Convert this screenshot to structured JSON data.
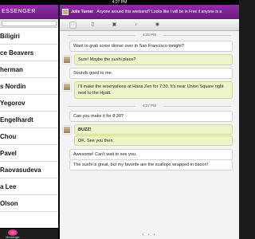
{
  "status_bar": {
    "time": "4:27 PM"
  },
  "left_panel": {
    "title": "ESSENGER",
    "contacts": [
      "Biligiri",
      "ce Beavers",
      "herman",
      "s Nordin",
      "Yegorov",
      "Engelhardt",
      "Chou",
      "Pavel",
      "Raovasudeva",
      "a Lee",
      "Olson"
    ],
    "footer_label": "Messenger"
  },
  "conversation": {
    "contact_name": "Julie Turner",
    "status_text": "Anyone around this weekend? Looks like I will be in Free if anyone is a",
    "time_1": "4:25 PM",
    "time_2": "4:27 PM",
    "messages": [
      {
        "from": "me",
        "text": "Want to grab some dinner over in San Francisco tonight?"
      },
      {
        "from": "them",
        "text": "Sure! Maybe the sushi place?"
      },
      {
        "from": "me",
        "text": "Sounds good to me."
      },
      {
        "from": "them",
        "text": "I'll make the reservations at Hana Zen for 7:30. It's near Union Square right next to the Hyatt."
      },
      {
        "from": "me",
        "text": "Can you make it for 8:30?"
      },
      {
        "from": "them",
        "text": "BUZZ!"
      },
      {
        "from": "them",
        "text": "OK. See you then."
      },
      {
        "from": "me",
        "text": "Awesome! Can't wait to see you."
      },
      {
        "from": "me",
        "text": "The sushi is great, but my favorite are the scallops wrapped in bacon!"
      }
    ]
  },
  "pager_dots": "• • •"
}
